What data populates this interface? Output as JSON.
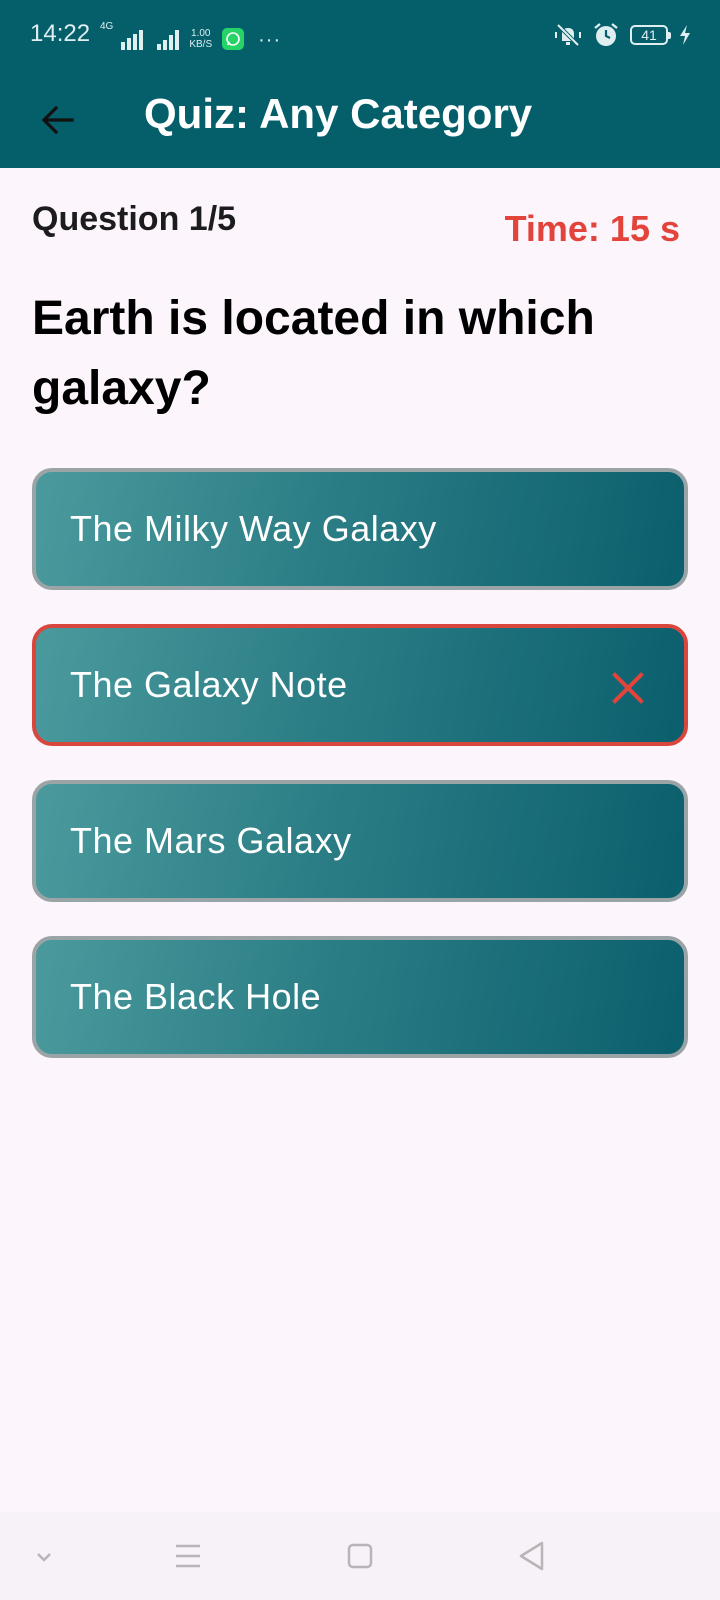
{
  "status_bar": {
    "time": "14:22",
    "network_type": "4G",
    "speed_value": "1.00",
    "speed_unit": "KB/S",
    "more": "···",
    "battery_level": "41",
    "icons": [
      "signal-icon",
      "whatsapp-icon",
      "mute-icon",
      "alarm-icon",
      "battery-icon",
      "charging-icon"
    ]
  },
  "app_bar": {
    "title": "Quiz: Any Category",
    "back_icon": "arrow-left-icon"
  },
  "quiz": {
    "question_counter": "Question 1/5",
    "timer": "Time: 15 s",
    "question_text": "Earth is located in which galaxy?",
    "answers": [
      {
        "label": "The Milky Way Galaxy",
        "state": "default"
      },
      {
        "label": "The Galaxy Note",
        "state": "wrong",
        "icon": "close-icon"
      },
      {
        "label": "The Mars Galaxy",
        "state": "default"
      },
      {
        "label": "The Black Hole",
        "state": "default"
      }
    ]
  },
  "nav_bar": {
    "buttons": [
      "chevron-down-icon",
      "menu-icon",
      "home-square-icon",
      "back-triangle-icon"
    ]
  },
  "colors": {
    "app_bar": "#055f6b",
    "background": "#fcf6fc",
    "timer": "#e2443c",
    "wrong_border": "#d8463e",
    "answer_border": "#9aa4a6"
  }
}
